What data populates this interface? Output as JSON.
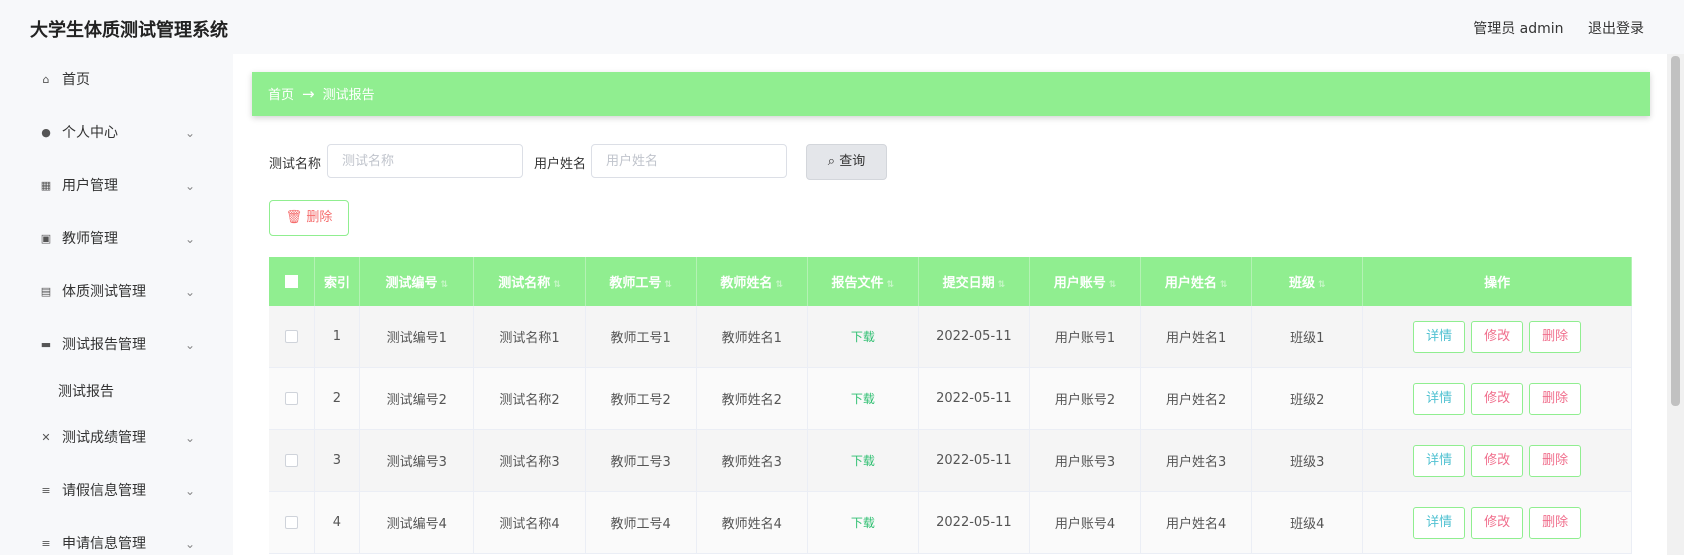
{
  "app": {
    "title": "大学生体质测试管理系统",
    "user": "管理员 admin",
    "logout": "退出登录"
  },
  "sidebar": {
    "items": [
      {
        "label": "首页",
        "icon": "home-icon",
        "glyph": "⌂",
        "has_arrow": false
      },
      {
        "label": "个人中心",
        "icon": "user-icon",
        "glyph": "●",
        "has_arrow": true
      },
      {
        "label": "用户管理",
        "icon": "grid-icon",
        "glyph": "▦",
        "has_arrow": true
      },
      {
        "label": "教师管理",
        "icon": "clipboard-icon",
        "glyph": "▣",
        "has_arrow": true
      },
      {
        "label": "体质测试管理",
        "icon": "clipboard-icon",
        "glyph": "▤",
        "has_arrow": true
      },
      {
        "label": "测试报告管理",
        "icon": "monitor-icon",
        "glyph": "▬",
        "has_arrow": true
      },
      {
        "label": "测试报告",
        "submenu": true
      },
      {
        "label": "测试成绩管理",
        "icon": "ticket-icon",
        "glyph": "✕",
        "has_arrow": true
      },
      {
        "label": "请假信息管理",
        "icon": "list-icon",
        "glyph": "≡",
        "has_arrow": true
      },
      {
        "label": "申请信息管理",
        "icon": "list-icon",
        "glyph": "≡",
        "has_arrow": true
      }
    ]
  },
  "breadcrumb": {
    "home": "首页",
    "sep": "→",
    "current": "测试报告"
  },
  "search": {
    "name_label": "测试名称",
    "name_placeholder": "测试名称",
    "user_label": "用户姓名",
    "user_placeholder": "用户姓名",
    "query_label": "查询"
  },
  "toolbar": {
    "delete_label": "删除"
  },
  "table": {
    "headers": [
      "索引",
      "测试编号",
      "测试名称",
      "教师工号",
      "教师姓名",
      "报告文件",
      "提交日期",
      "用户账号",
      "用户姓名",
      "班级",
      "操作"
    ],
    "rows": [
      {
        "index": "1",
        "test_no": "测试编号1",
        "test_name": "测试名称1",
        "teacher_no": "教师工号1",
        "teacher_name": "教师姓名1",
        "file": "下载",
        "date": "2022-05-11",
        "account": "用户账号1",
        "user_name": "用户姓名1",
        "class": "班级1"
      },
      {
        "index": "2",
        "test_no": "测试编号2",
        "test_name": "测试名称2",
        "teacher_no": "教师工号2",
        "teacher_name": "教师姓名2",
        "file": "下载",
        "date": "2022-05-11",
        "account": "用户账号2",
        "user_name": "用户姓名2",
        "class": "班级2"
      },
      {
        "index": "3",
        "test_no": "测试编号3",
        "test_name": "测试名称3",
        "teacher_no": "教师工号3",
        "teacher_name": "教师姓名3",
        "file": "下载",
        "date": "2022-05-11",
        "account": "用户账号3",
        "user_name": "用户姓名3",
        "class": "班级3"
      },
      {
        "index": "4",
        "test_no": "测试编号4",
        "test_name": "测试名称4",
        "teacher_no": "教师工号4",
        "teacher_name": "教师姓名4",
        "file": "下载",
        "date": "2022-05-11",
        "account": "用户账号4",
        "user_name": "用户姓名4",
        "class": "班级4"
      }
    ],
    "actions": {
      "detail": "详情",
      "edit": "修改",
      "delete": "删除"
    }
  },
  "colors": {
    "accent": "#90ee90",
    "danger": "#f56c6c",
    "link": "#2fbf71"
  }
}
